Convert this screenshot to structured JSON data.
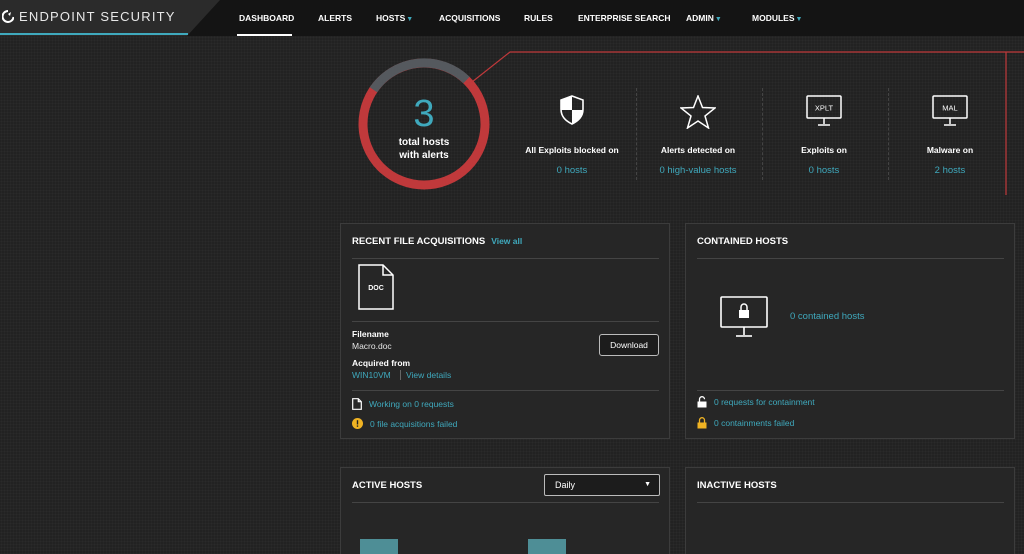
{
  "header": {
    "brand": "ENDPOINT SECURITY",
    "nav": [
      {
        "label": "DASHBOARD",
        "dropdown": false,
        "active": true
      },
      {
        "label": "ALERTS",
        "dropdown": false
      },
      {
        "label": "HOSTS",
        "dropdown": true
      },
      {
        "label": "ACQUISITIONS",
        "dropdown": false
      },
      {
        "label": "RULES",
        "dropdown": false
      },
      {
        "label": "ENTERPRISE SEARCH",
        "dropdown": false
      },
      {
        "label": "ADMIN",
        "dropdown": true
      },
      {
        "label": "MODULES",
        "dropdown": true
      }
    ]
  },
  "summary": {
    "count": "3",
    "label_line1": "total hosts",
    "label_line2": "with alerts",
    "stats": [
      {
        "icon": "shield-icon",
        "title": "All Exploits blocked on",
        "value": "0  hosts"
      },
      {
        "icon": "star-icon",
        "title": "Alerts detected on",
        "value": "0  high-value hosts"
      },
      {
        "icon": "xplt-monitor-icon",
        "icon_text": "XPLT",
        "title": "Exploits on",
        "value": "0  hosts"
      },
      {
        "icon": "mal-monitor-icon",
        "icon_text": "MAL",
        "title": "Malware on",
        "value": "2  hosts"
      }
    ]
  },
  "recent_acquisitions": {
    "title": "RECENT FILE ACQUISITIONS",
    "view_all": "View all",
    "doc_icon_text": "DOC",
    "filename_label": "Filename",
    "filename": "Macro.doc",
    "download": "Download",
    "acquired_label": "Acquired from",
    "host": "WIN10VM",
    "view_details": "View details",
    "working": "Working on 0 requests",
    "failed": "0 file acquisitions failed"
  },
  "contained_hosts": {
    "title": "CONTAINED HOSTS",
    "count_text": "0 contained hosts",
    "requests": "0 requests for containment",
    "failed": "0 containments failed"
  },
  "active_hosts": {
    "title": "ACTIVE HOSTS",
    "period": "Daily"
  },
  "inactive_hosts": {
    "title": "INACTIVE HOSTS"
  },
  "colors": {
    "accent": "#3fa9bd",
    "alert_red": "#c0393b",
    "warning": "#f0b323"
  }
}
